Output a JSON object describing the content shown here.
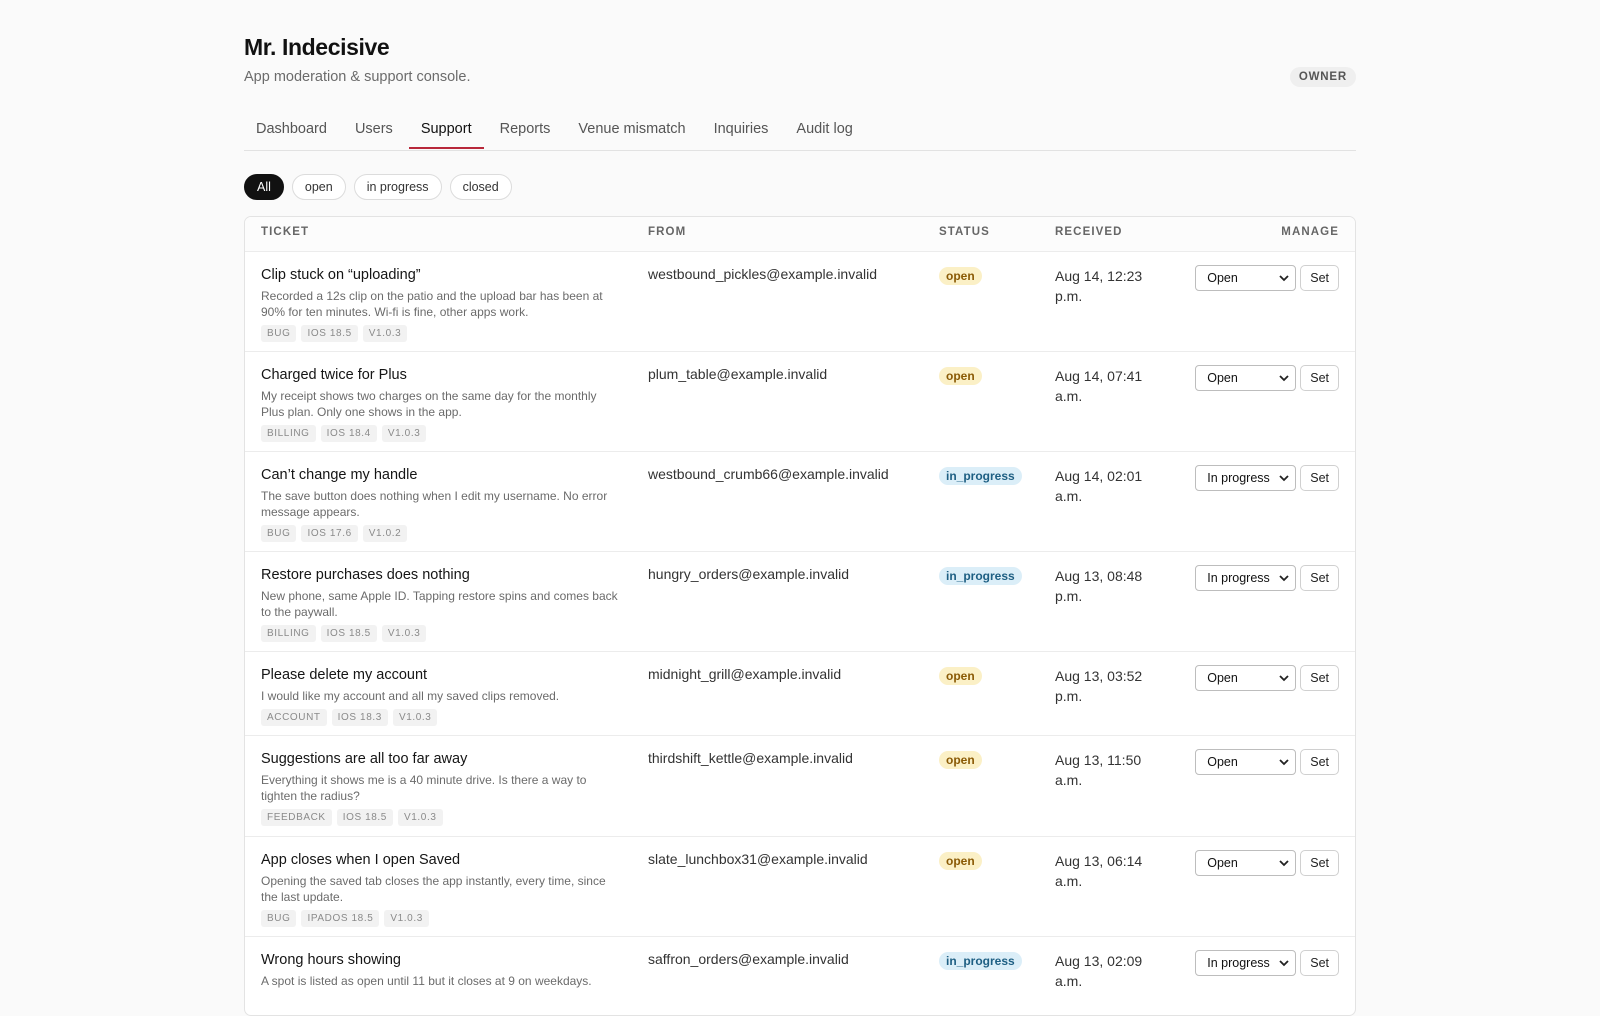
{
  "app": {
    "title": "Mr. Indecisive",
    "subtitle": "App moderation & support console.",
    "role_badge": "OWNER"
  },
  "tabs": [
    {
      "label": "Dashboard",
      "active": false
    },
    {
      "label": "Users",
      "active": false
    },
    {
      "label": "Support",
      "active": true
    },
    {
      "label": "Reports",
      "active": false
    },
    {
      "label": "Venue mismatch",
      "active": false
    },
    {
      "label": "Inquiries",
      "active": false
    },
    {
      "label": "Audit log",
      "active": false
    }
  ],
  "filters": [
    {
      "label": "All",
      "active": true
    },
    {
      "label": "open",
      "active": false
    },
    {
      "label": "in progress",
      "active": false
    },
    {
      "label": "closed",
      "active": false
    }
  ],
  "table": {
    "columns": {
      "ticket": "TICKET",
      "from": "FROM",
      "status": "STATUS",
      "received": "RECEIVED",
      "manage": "MANAGE"
    },
    "set_label": "Set",
    "rows": [
      {
        "subject": "Clip stuck on “uploading”",
        "body": "Recorded a 12s clip on the patio and the upload bar has been at 90% for ten minutes. Wi-fi is fine, other apps work.",
        "tags": [
          "BUG",
          "IOS 18.5",
          "V1.0.3"
        ],
        "from": "westbound_pickles@example.invalid",
        "status": "open",
        "received": "Aug 14, 12:23 p.m.",
        "select_value": "Open"
      },
      {
        "subject": "Charged twice for Plus",
        "body": "My receipt shows two charges on the same day for the monthly Plus plan. Only one shows in the app.",
        "tags": [
          "BILLING",
          "IOS 18.4",
          "V1.0.3"
        ],
        "from": "plum_table@example.invalid",
        "status": "open",
        "received": "Aug 14, 07:41 a.m.",
        "select_value": "Open"
      },
      {
        "subject": "Can’t change my handle",
        "body": "The save button does nothing when I edit my username. No error message appears.",
        "tags": [
          "BUG",
          "IOS 17.6",
          "V1.0.2"
        ],
        "from": "westbound_crumb66@example.invalid",
        "status": "in_progress",
        "received": "Aug 14, 02:01 a.m.",
        "select_value": "In progress"
      },
      {
        "subject": "Restore purchases does nothing",
        "body": "New phone, same Apple ID. Tapping restore spins and comes back to the paywall.",
        "tags": [
          "BILLING",
          "IOS 18.5",
          "V1.0.3"
        ],
        "from": "hungry_orders@example.invalid",
        "status": "in_progress",
        "received": "Aug 13, 08:48 p.m.",
        "select_value": "In progress"
      },
      {
        "subject": "Please delete my account",
        "body": "I would like my account and all my saved clips removed.",
        "tags": [
          "ACCOUNT",
          "IOS 18.3",
          "V1.0.3"
        ],
        "from": "midnight_grill@example.invalid",
        "status": "open",
        "received": "Aug 13, 03:52 p.m.",
        "select_value": "Open"
      },
      {
        "subject": "Suggestions are all too far away",
        "body": "Everything it shows me is a 40 minute drive. Is there a way to tighten the radius?",
        "tags": [
          "FEEDBACK",
          "IOS 18.5",
          "V1.0.3"
        ],
        "from": "thirdshift_kettle@example.invalid",
        "status": "open",
        "received": "Aug 13, 11:50 a.m.",
        "select_value": "Open"
      },
      {
        "subject": "App closes when I open Saved",
        "body": "Opening the saved tab closes the app instantly, every time, since the last update.",
        "tags": [
          "BUG",
          "IPADOS 18.5",
          "V1.0.3"
        ],
        "from": "slate_lunchbox31@example.invalid",
        "status": "open",
        "received": "Aug 13, 06:14 a.m.",
        "select_value": "Open"
      },
      {
        "subject": "Wrong hours showing",
        "body": "A spot is listed as open until 11 but it closes at 9 on weekdays.",
        "tags": [],
        "from": "saffron_orders@example.invalid",
        "status": "in_progress",
        "received": "Aug 13, 02:09 a.m.",
        "select_value": "In progress"
      }
    ]
  },
  "colors": {
    "accent": "#b8283a",
    "open_badge_bg": "#fbf0c6",
    "in_progress_badge_bg": "#dbeef8"
  }
}
